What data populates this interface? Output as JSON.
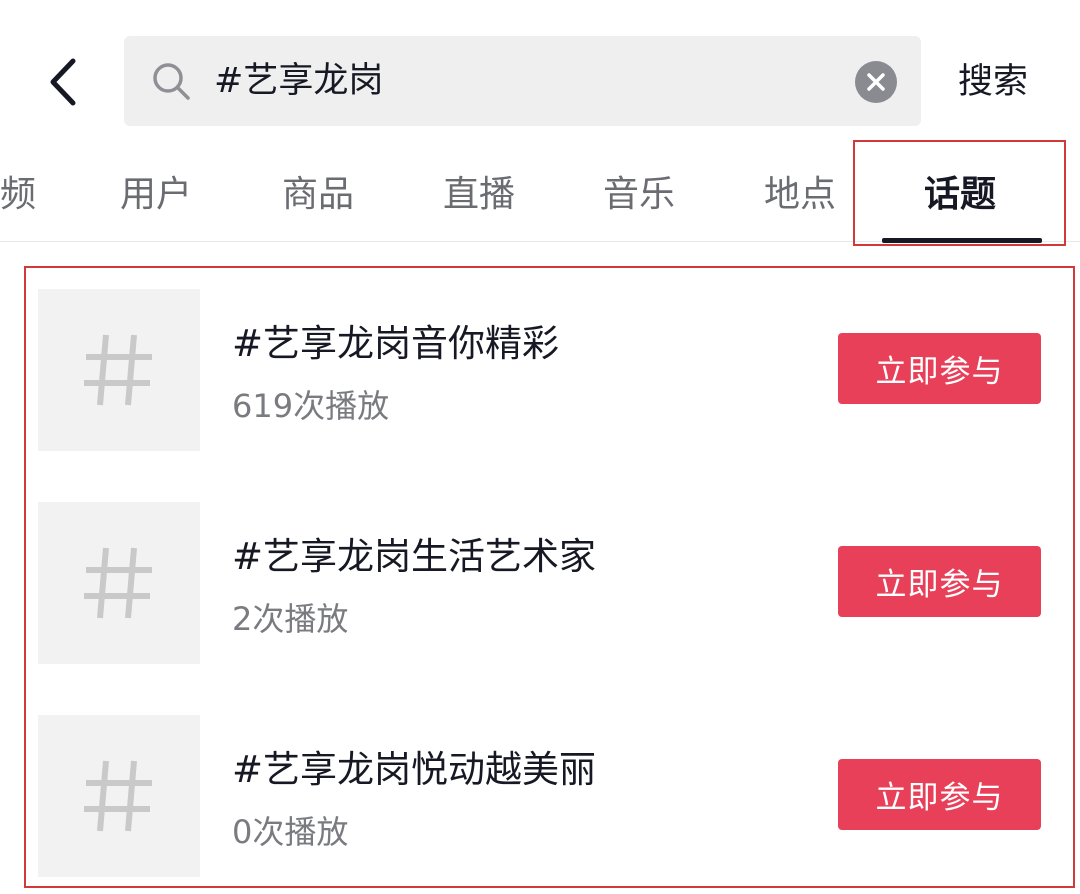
{
  "header": {
    "search_query": "#艺享龙岗",
    "search_button": "搜索",
    "icons": {
      "back": "chevron-left-icon",
      "search": "search-icon",
      "clear": "clear-icon"
    }
  },
  "tabs": [
    {
      "label": "频",
      "active": false
    },
    {
      "label": "用户",
      "active": false
    },
    {
      "label": "商品",
      "active": false
    },
    {
      "label": "直播",
      "active": false
    },
    {
      "label": "音乐",
      "active": false
    },
    {
      "label": "地点",
      "active": false
    },
    {
      "label": "话题",
      "active": true
    }
  ],
  "topics": [
    {
      "title": "#艺享龙岗音你精彩",
      "views": "619次播放",
      "action": "立即参与",
      "icon": "hashtag-icon"
    },
    {
      "title": "#艺享龙岗生活艺术家",
      "views": "2次播放",
      "action": "立即参与",
      "icon": "hashtag-icon"
    },
    {
      "title": "#艺享龙岗悦动越美丽",
      "views": "0次播放",
      "action": "立即参与",
      "icon": "hashtag-icon"
    }
  ],
  "colors": {
    "accent": "#e9405a",
    "highlight_border": "#d23a3a",
    "text_primary": "#161823",
    "text_secondary": "#7a7b80"
  }
}
